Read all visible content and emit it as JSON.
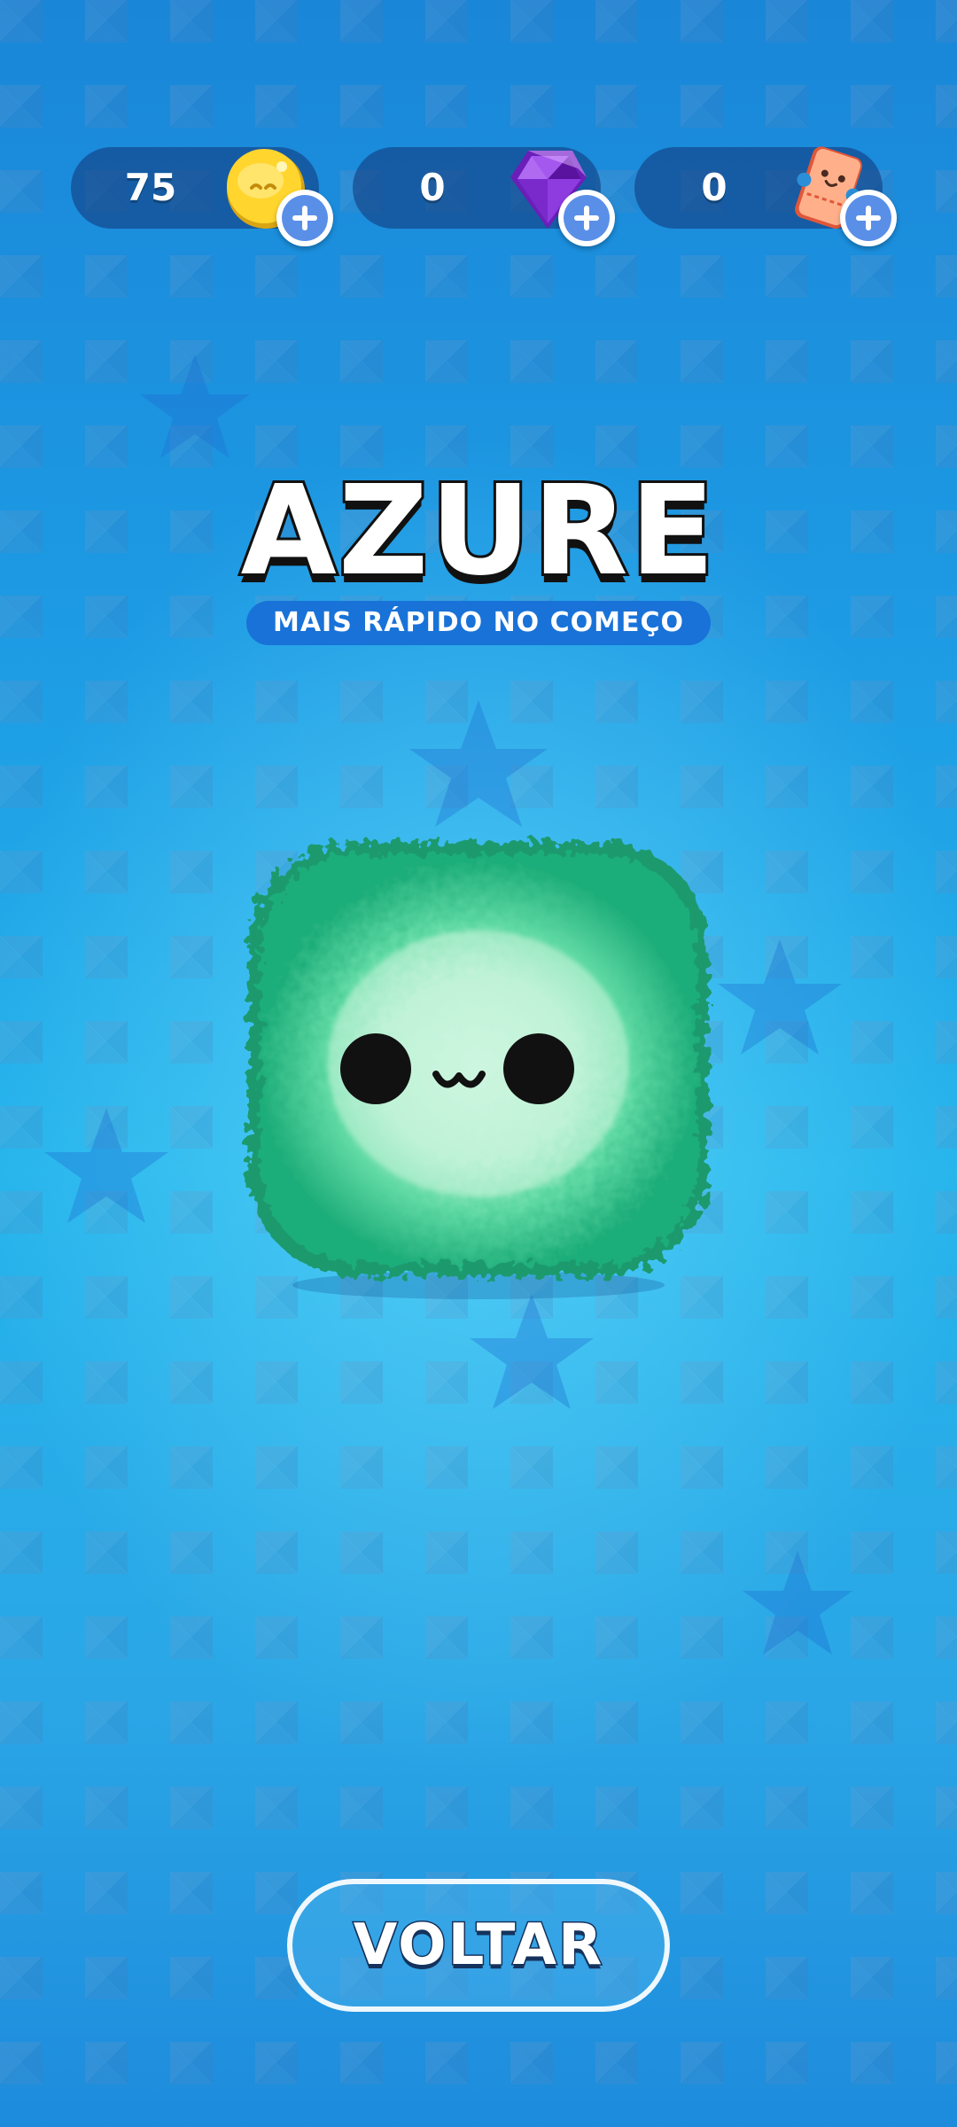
{
  "currencies": [
    {
      "name": "coins",
      "amount": "75"
    },
    {
      "name": "gems",
      "amount": "0"
    },
    {
      "name": "tickets",
      "amount": "0"
    }
  ],
  "character": {
    "name": "AZURE",
    "perk": "MAIS RÁPIDO NO COMEÇO"
  },
  "buttons": {
    "back_label": "VOLTAR"
  },
  "icons": {
    "coins": "coin-icon",
    "gems": "gem-icon",
    "tickets": "ticket-icon",
    "add": "plus-icon"
  },
  "colors": {
    "background": "#1d9be4",
    "character_fur": "#2fc48a",
    "character_face": "#c8f5dc",
    "subtitle_badge": "#1872d8",
    "plus_badge": "#5a8fe8"
  }
}
